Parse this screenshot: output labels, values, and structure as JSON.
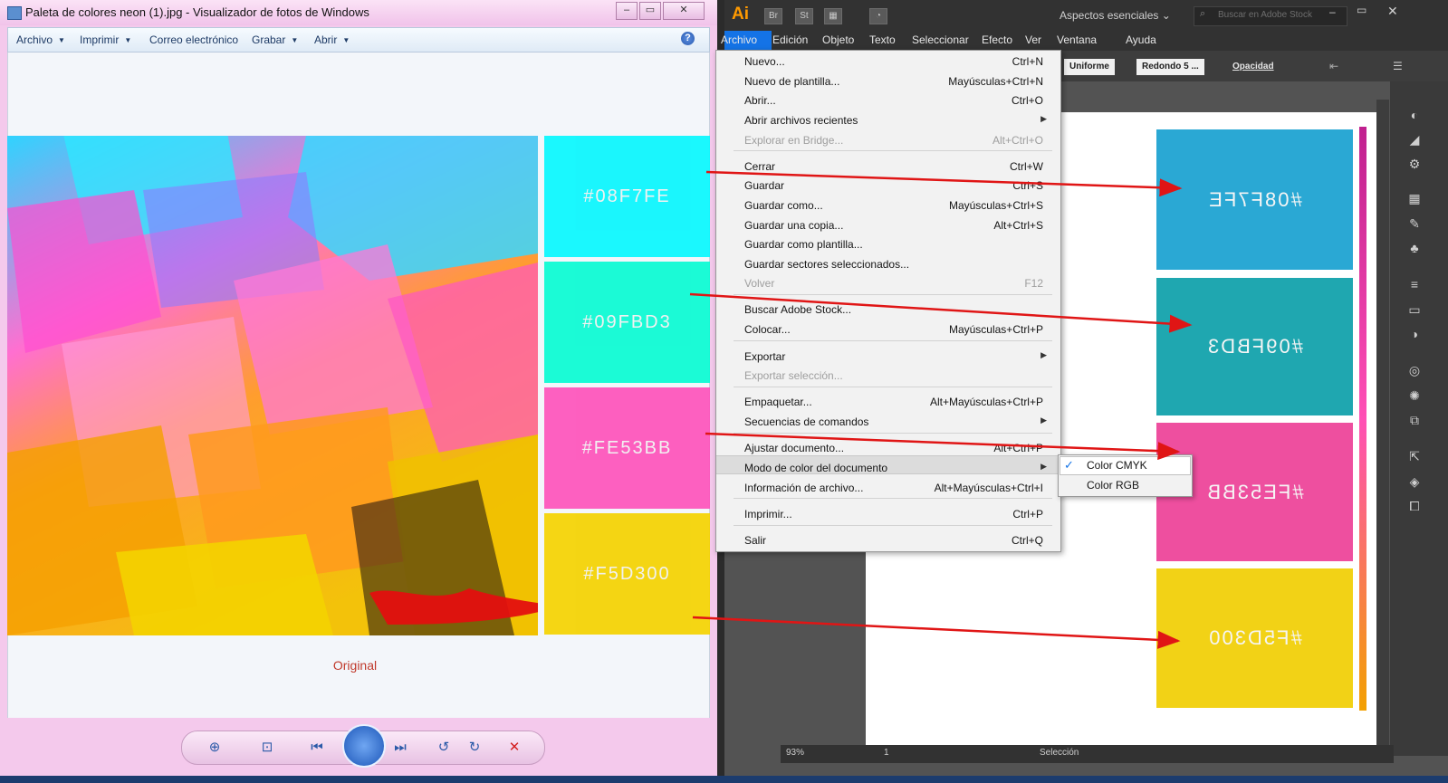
{
  "viewer": {
    "title": "Paleta de colores neon (1).jpg - Visualizador de fotos de Windows",
    "menu": [
      "Archivo",
      "Imprimir",
      "Correo electrónico",
      "Grabar",
      "Abrir"
    ],
    "help_label": "?",
    "caption": "Original",
    "swatches": [
      {
        "hex": "#08F7FE",
        "color": "#08f7fe"
      },
      {
        "hex": "#09FBD3",
        "color": "#09fbd3"
      },
      {
        "hex": "#FE53BB",
        "color": "#fe53bb"
      },
      {
        "hex": "#F5D300",
        "color": "#f5d300"
      }
    ],
    "controls": [
      "zoom-icon",
      "fit-icon",
      "previous-icon",
      "slideshow-icon",
      "next-icon",
      "rotate-left-icon",
      "rotate-right-icon",
      "delete-icon"
    ]
  },
  "illustrator": {
    "logo": "Ai",
    "app_icons": [
      "Br",
      "St"
    ],
    "workspace": "Aspectos esenciales",
    "search_placeholder": "Buscar en Adobe Stock",
    "menu": [
      "Archivo",
      "Edición",
      "Objeto",
      "Texto",
      "Seleccionar",
      "Efecto",
      "Ver",
      "Ventana",
      "Ayuda"
    ],
    "control_bar": {
      "stroke_profile": "Uniforme",
      "brush": "Redondo 5 ...",
      "opacity": "Opacidad"
    },
    "artboard_swatches": [
      {
        "hex": "#08F7FE",
        "color": "#2aa8d4"
      },
      {
        "hex": "#09FBD3",
        "color": "#1fa7b0"
      },
      {
        "hex": "#FE53BB",
        "color": "#ee4f9f"
      },
      {
        "hex": "#F5D300",
        "color": "#f2d216"
      }
    ],
    "status": {
      "zoom": "93%",
      "page": "1",
      "tool": "Selección"
    }
  },
  "file_menu": {
    "items": [
      {
        "label": "Nuevo...",
        "shortcut": "Ctrl+N"
      },
      {
        "label": "Nuevo de plantilla...",
        "shortcut": "Mayúsculas+Ctrl+N"
      },
      {
        "label": "Abrir...",
        "shortcut": "Ctrl+O"
      },
      {
        "label": "Abrir archivos recientes",
        "shortcut": "",
        "submenu": true
      },
      {
        "label": "Explorar en Bridge...",
        "shortcut": "Alt+Ctrl+O",
        "disabled": true
      },
      {
        "label": "Cerrar",
        "shortcut": "Ctrl+W"
      },
      {
        "label": "Guardar",
        "shortcut": "Ctrl+S"
      },
      {
        "label": "Guardar como...",
        "shortcut": "Mayúsculas+Ctrl+S"
      },
      {
        "label": "Guardar una copia...",
        "shortcut": "Alt+Ctrl+S"
      },
      {
        "label": "Guardar como plantilla...",
        "shortcut": ""
      },
      {
        "label": "Guardar sectores seleccionados...",
        "shortcut": ""
      },
      {
        "label": "Volver",
        "shortcut": "F12",
        "disabled": true
      },
      {
        "label": "Buscar Adobe Stock...",
        "shortcut": ""
      },
      {
        "label": "Colocar...",
        "shortcut": "Mayúsculas+Ctrl+P"
      },
      {
        "label": "Exportar",
        "shortcut": "",
        "submenu": true
      },
      {
        "label": "Exportar selección...",
        "shortcut": "",
        "disabled": true
      },
      {
        "label": "Empaquetar...",
        "shortcut": "Alt+Mayúsculas+Ctrl+P"
      },
      {
        "label": "Secuencias de comandos",
        "shortcut": "",
        "submenu": true
      },
      {
        "label": "Ajustar documento...",
        "shortcut": "Alt+Ctrl+P"
      },
      {
        "label": "Modo de color del documento",
        "shortcut": "",
        "submenu": true,
        "highlighted": true
      },
      {
        "label": "Información de archivo...",
        "shortcut": "Alt+Mayúsculas+Ctrl+I"
      },
      {
        "label": "Imprimir...",
        "shortcut": "Ctrl+P"
      },
      {
        "label": "Salir",
        "shortcut": "Ctrl+Q"
      }
    ],
    "color_mode_submenu": [
      {
        "label": "Color CMYK",
        "checked": true
      },
      {
        "label": "Color RGB",
        "checked": false
      }
    ]
  }
}
